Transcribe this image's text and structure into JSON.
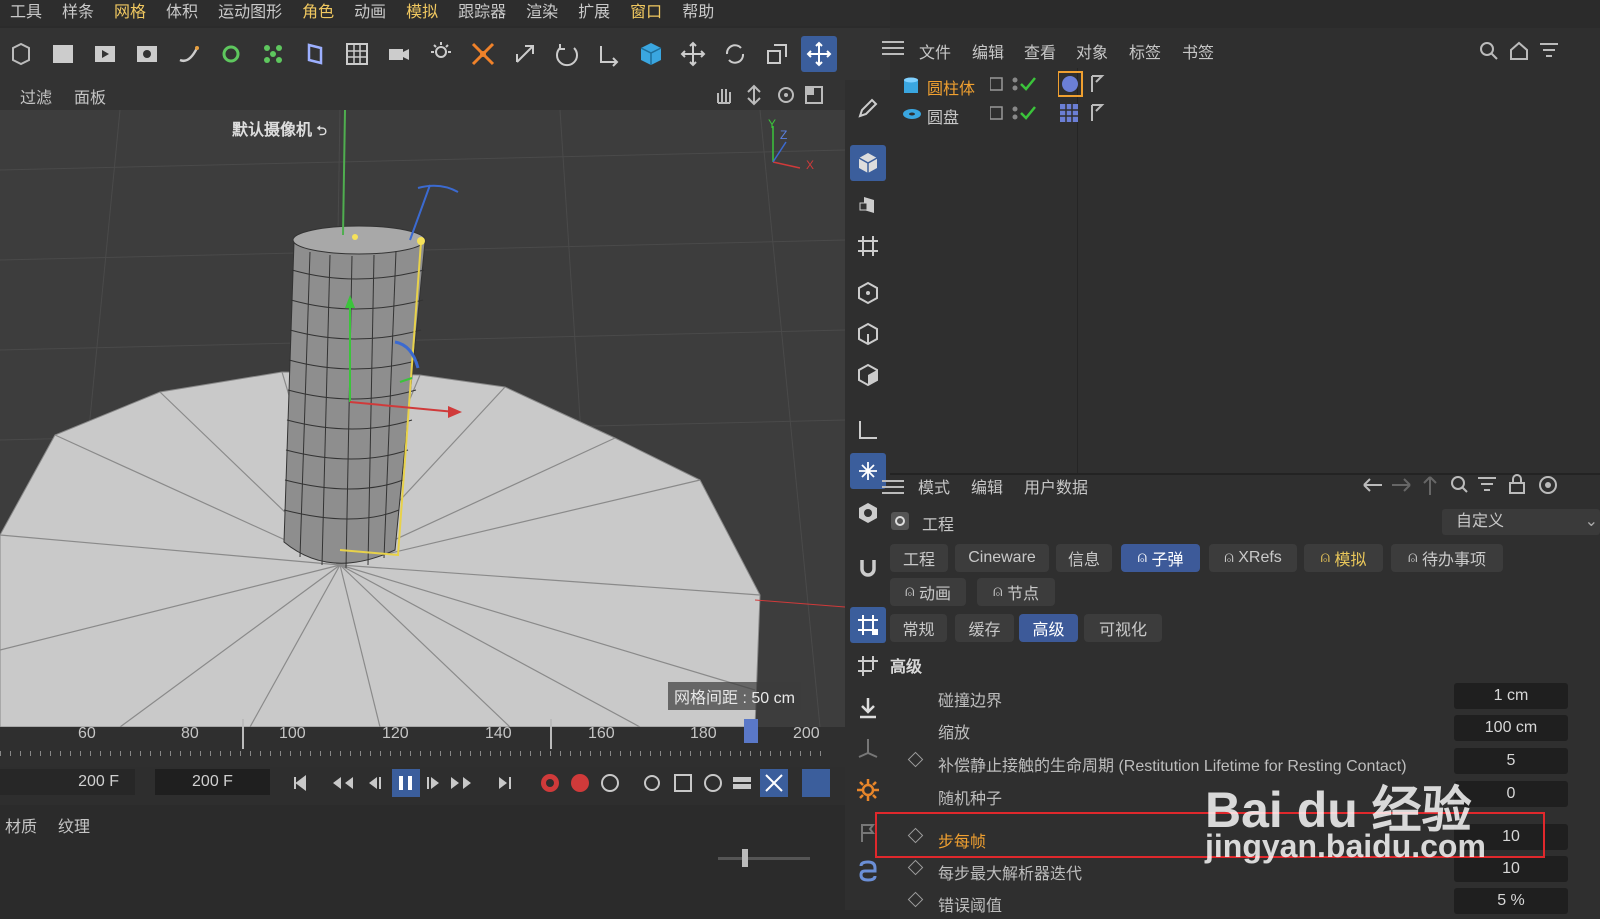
{
  "menu": [
    "工具",
    "样条",
    "网格",
    "体积",
    "运动图形",
    "角色",
    "动画",
    "模拟",
    "跟踪器",
    "渲染",
    "扩展",
    "窗口",
    "帮助"
  ],
  "menu_highlight": [
    "网格",
    "角色",
    "模拟",
    "窗口"
  ],
  "viewport": {
    "header_items": [
      "过滤",
      "面板"
    ],
    "camera_label": "默认摄像机",
    "grid_spacing": "网格间距 : 50 cm",
    "axis_labels": {
      "y": "Y",
      "z": "Z",
      "x": "X"
    }
  },
  "timeline": {
    "ticks": [
      "60",
      "80",
      "100",
      "120",
      "140",
      "160",
      "180",
      "200"
    ],
    "current_frame": "200 F",
    "end_frame": "200 F"
  },
  "bottom_tabs": [
    "材质",
    "纹理"
  ],
  "object_manager": {
    "menu": [
      "文件",
      "编辑",
      "查看",
      "对象",
      "标签",
      "书签"
    ],
    "objects": [
      {
        "name": "圆柱体",
        "selected": true
      },
      {
        "name": "圆盘",
        "selected": false
      }
    ]
  },
  "attribute_manager": {
    "menu": [
      "模式",
      "编辑",
      "用户数据"
    ],
    "title": "工程",
    "preset": "自定义",
    "tabs_row1": [
      "工程",
      "Cineware",
      "信息",
      "子弹",
      "XRefs",
      "模拟",
      "待办事项"
    ],
    "tabs_row2": [
      "动画",
      "节点"
    ],
    "subtabs": [
      "常规",
      "缓存",
      "高级",
      "可视化"
    ],
    "section": "高级",
    "params": [
      {
        "label": "碰撞边界",
        "value": "1 cm",
        "anim": false
      },
      {
        "label": "缩放",
        "value": "100 cm",
        "anim": false
      },
      {
        "label": "补偿静止接触的生命周期 (Restitution Lifetime for Resting Contact)",
        "value": "5",
        "anim": true
      },
      {
        "label": "随机种子",
        "value": "0",
        "anim": false
      },
      {
        "label": "步每帧",
        "value": "10",
        "anim": true,
        "highlight": true
      },
      {
        "label": "每步最大解析器迭代",
        "value": "10",
        "anim": true
      },
      {
        "label": "错误阈值",
        "value": "5 %",
        "anim": true
      }
    ]
  },
  "watermark": {
    "brand": "Bai du 经验",
    "url": "jingyan.baidu.com"
  },
  "colors": {
    "accent": "#3d5a99",
    "highlight_text": "#f0a030",
    "menu_yellow": "#f0c860",
    "red_box": "#e0282c"
  }
}
